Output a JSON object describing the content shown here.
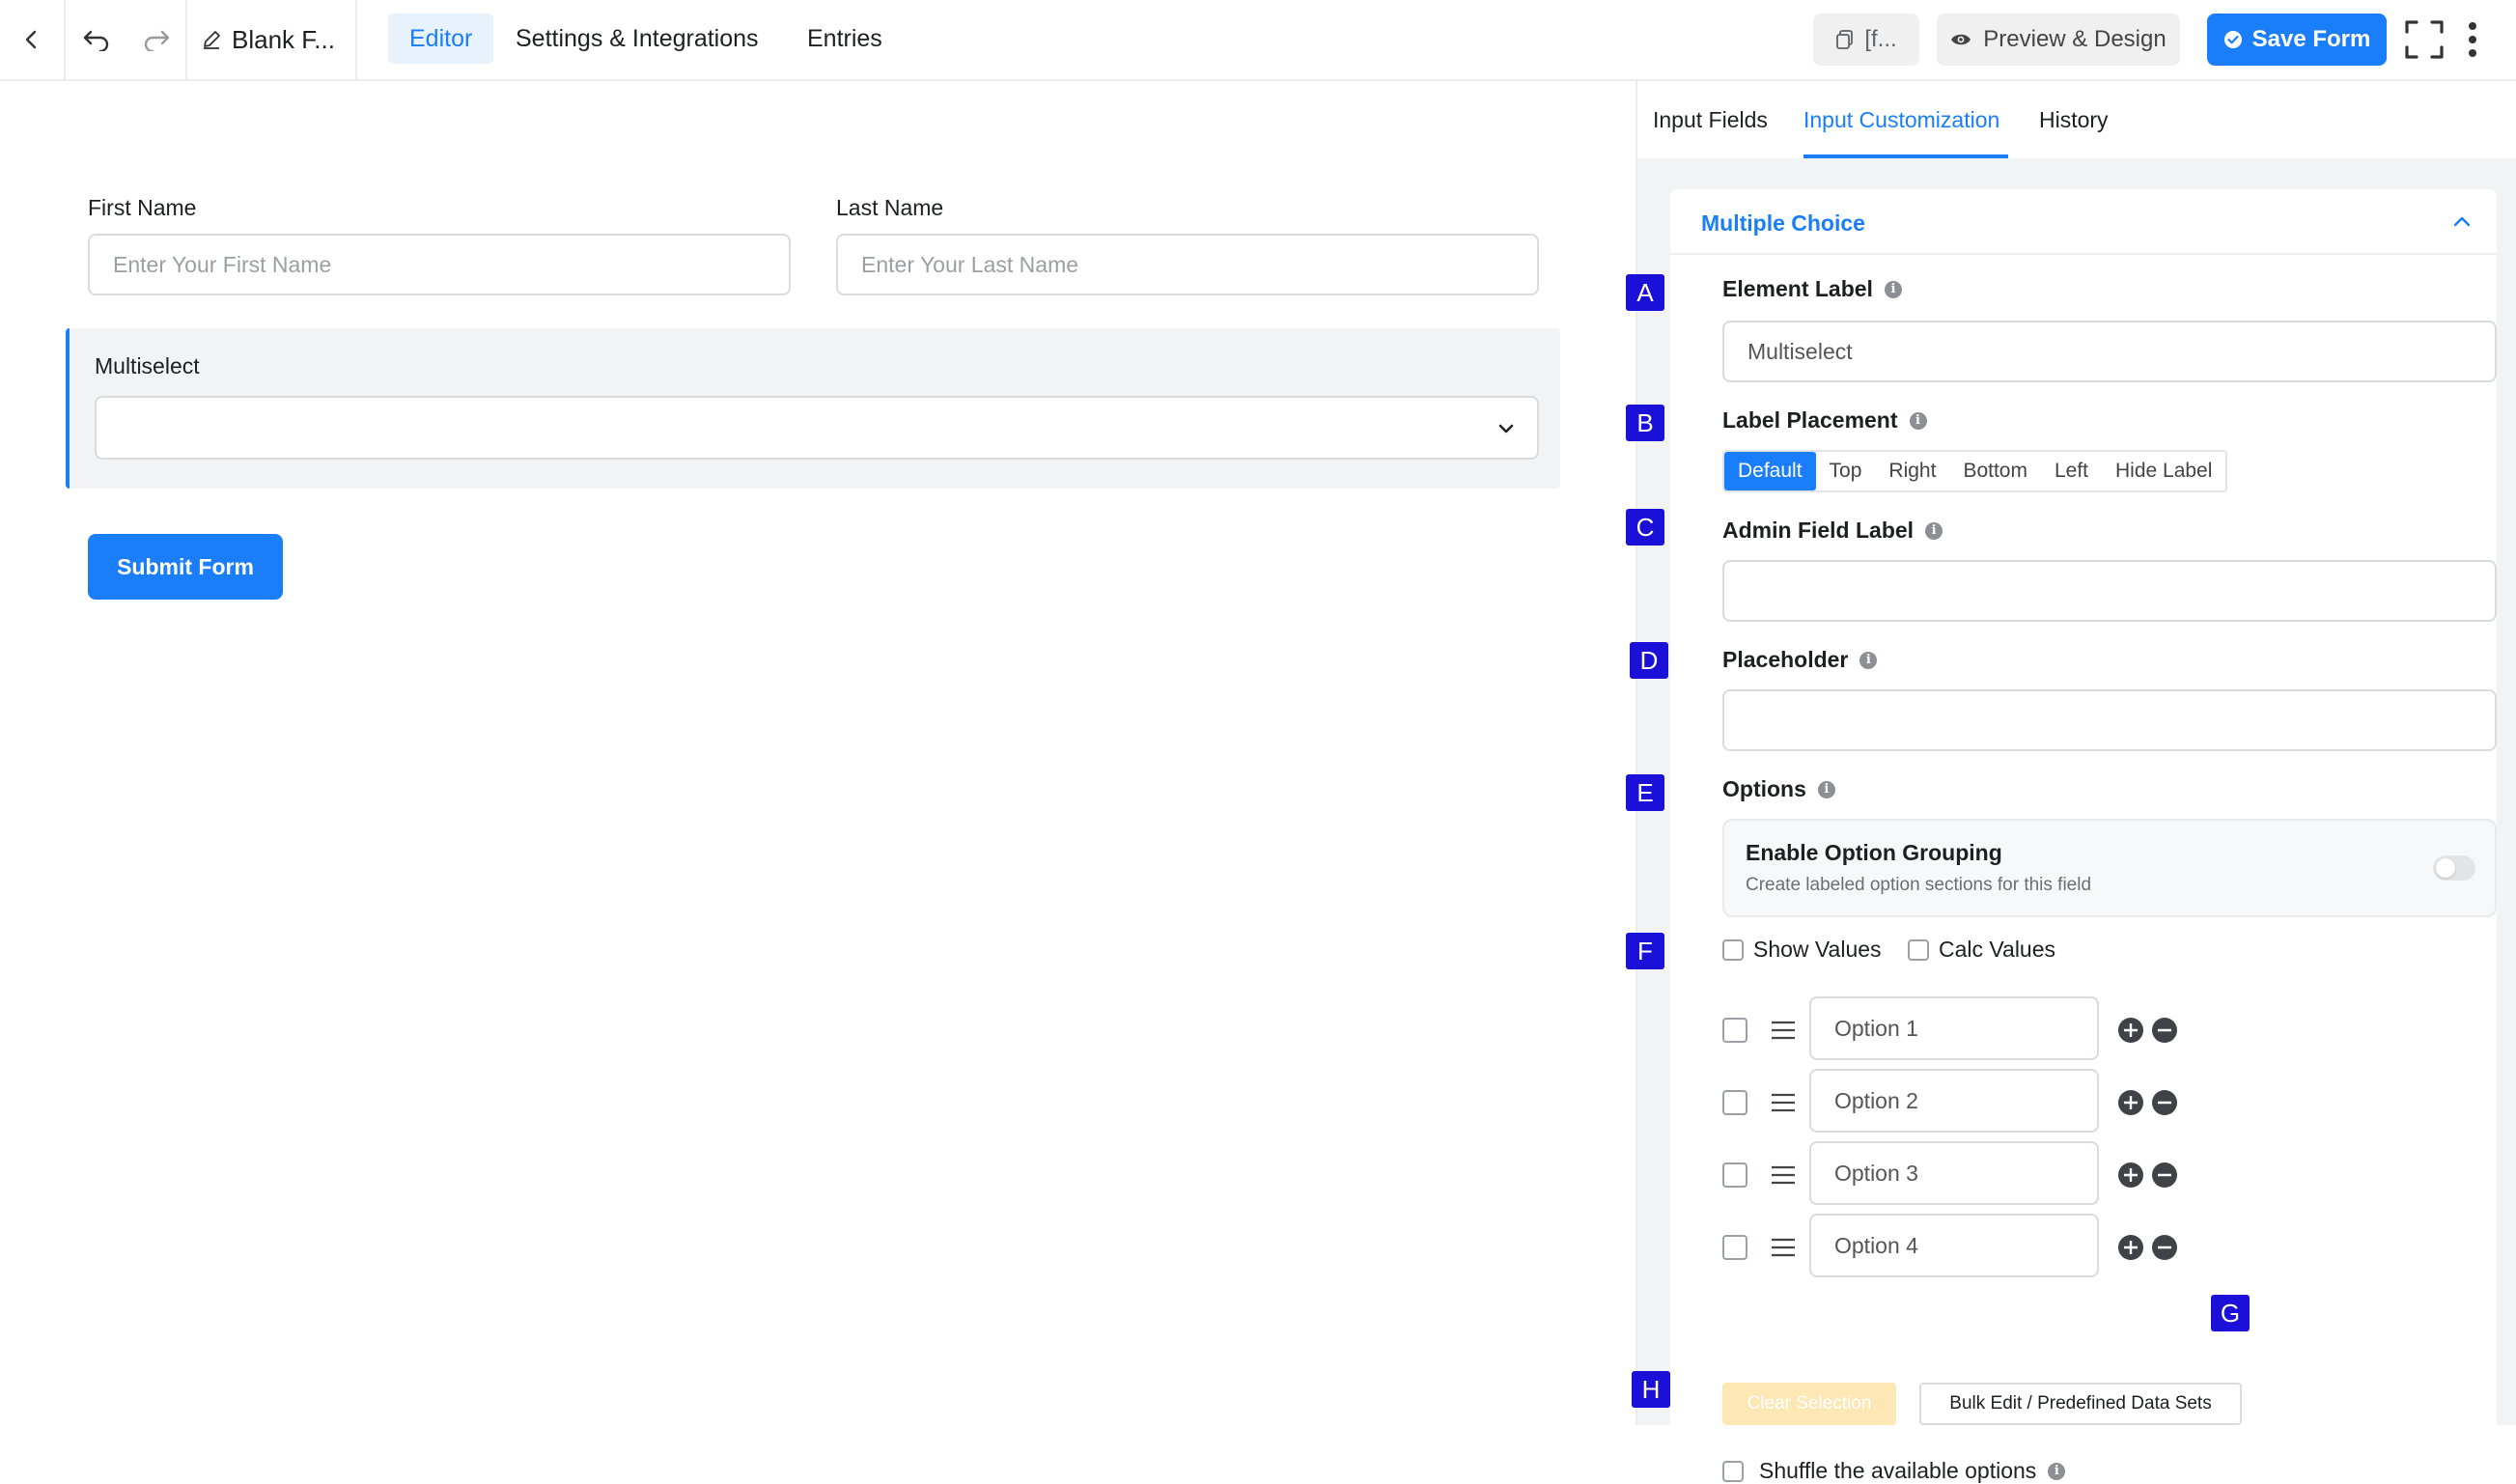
{
  "topbar": {
    "form_title": "Blank F...",
    "tabs": [
      "Editor",
      "Settings & Integrations",
      "Entries"
    ],
    "shortcode_label": "[f...",
    "preview_label": "Preview & Design",
    "save_label": "Save Form"
  },
  "form": {
    "first_name_label": "First Name",
    "first_name_placeholder": "Enter Your First Name",
    "last_name_label": "Last Name",
    "last_name_placeholder": "Enter Your Last Name",
    "multiselect_label": "Multiselect",
    "submit_label": "Submit Form"
  },
  "panel": {
    "tabs": [
      "Input Fields",
      "Input Customization",
      "History"
    ],
    "card_title": "Multiple Choice",
    "element_label": "Element Label",
    "element_label_value": "Multiselect",
    "label_placement": "Label Placement",
    "placement_options": [
      "Default",
      "Top",
      "Right",
      "Bottom",
      "Left",
      "Hide Label"
    ],
    "placement_selected": "Default",
    "admin_field_label": "Admin Field Label",
    "placeholder_label": "Placeholder",
    "options_label": "Options",
    "grouping_title": "Enable Option Grouping",
    "grouping_sub": "Create labeled option sections for this field",
    "show_values": "Show Values",
    "calc_values": "Calc Values",
    "options": [
      "Option 1",
      "Option 2",
      "Option 3",
      "Option 4"
    ],
    "clear_selection": "Clear Selection",
    "bulk_edit": "Bulk Edit / Predefined Data Sets",
    "shuffle": "Shuffle the available options"
  },
  "markers": [
    "A",
    "B",
    "C",
    "D",
    "E",
    "F",
    "G",
    "H"
  ],
  "colors": {
    "accent": "#1a7efb",
    "marker": "#1a10d8"
  }
}
